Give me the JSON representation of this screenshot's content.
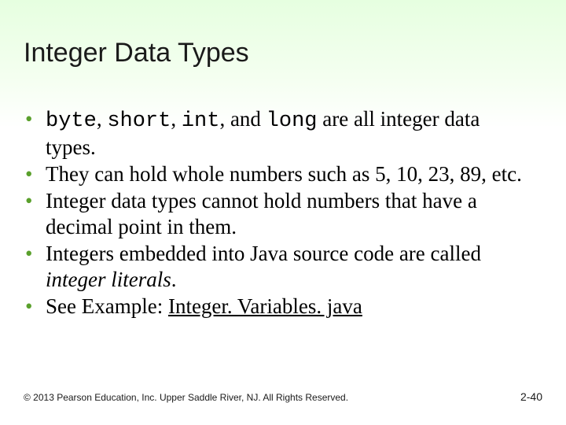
{
  "title": "Integer Data Types",
  "bullets": {
    "b1": {
      "t1": "byte",
      "t2": ", ",
      "t3": "short",
      "t4": ", ",
      "t5": "int",
      "t6": ", and ",
      "t7": "long",
      "t8": " are all integer data types."
    },
    "b2": "They can hold whole numbers such as 5, 10, 23, 89, etc.",
    "b3": "Integer data types cannot hold numbers that have a decimal point in them.",
    "b4": {
      "t1": "Integers embedded into Java source code are called ",
      "t2": "integer literals",
      "t3": "."
    },
    "b5": {
      "t1": "See Example: ",
      "t2": "Integer. Variables. java"
    }
  },
  "footer": {
    "copyright": "© 2013 Pearson Education, Inc. Upper Saddle River, NJ. All Rights Reserved.",
    "pagenum": "2-40"
  }
}
